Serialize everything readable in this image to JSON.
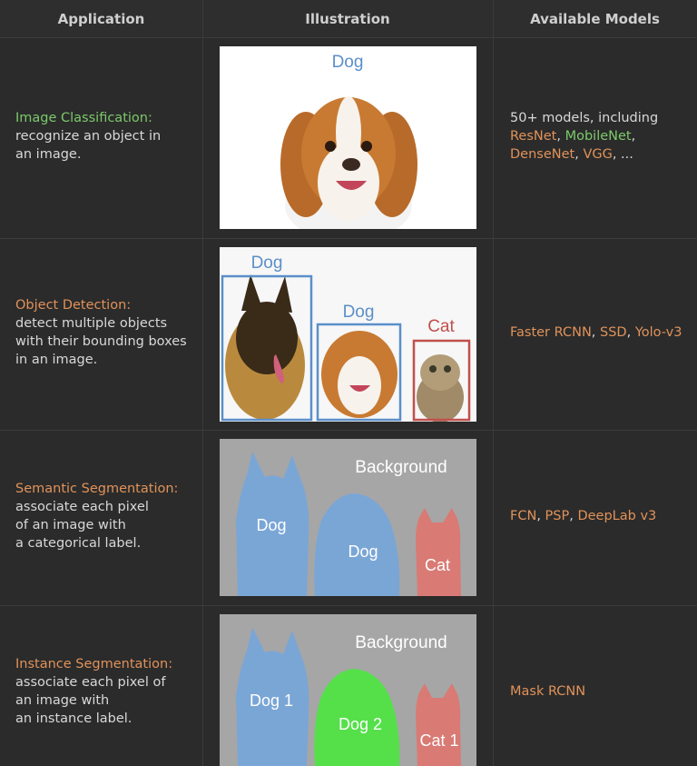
{
  "header": {
    "application": "Application",
    "illustration": "Illustration",
    "models": "Available Models"
  },
  "rows": [
    {
      "title": "Image Classification:",
      "desc": [
        "recognize an object in",
        "an image."
      ],
      "models_line1": "50+ models, including",
      "models": [
        "ResNet",
        ", ",
        "MobileNet",
        ",",
        "DenseNet",
        ", ",
        "VGG",
        ", ..."
      ],
      "labels": [
        "Dog"
      ]
    },
    {
      "title": "Object Detection:",
      "desc": [
        "detect multiple objects",
        "with their bounding boxes",
        "in an image."
      ],
      "models": [
        "Faster RCNN",
        ", ",
        "SSD",
        ", ",
        "Yolo-v3"
      ],
      "labels": [
        "Dog",
        "Dog",
        "Cat"
      ]
    },
    {
      "title": "Semantic Segmentation:",
      "desc": [
        "associate each pixel",
        "of an image with",
        "a categorical label."
      ],
      "models": [
        "FCN",
        ", ",
        "PSP",
        ", ",
        "DeepLab v3"
      ],
      "labels": [
        "Background",
        "Dog",
        "Dog",
        "Cat"
      ]
    },
    {
      "title": "Instance Segmentation:",
      "desc": [
        "associate each pixel of",
        "an image with",
        "an instance label."
      ],
      "models": [
        "Mask RCNN"
      ],
      "labels": [
        "Background",
        "Dog 1",
        "Dog 2",
        "Cat 1"
      ]
    }
  ],
  "colors": {
    "green": "#7cc96a",
    "orange": "#e0925a",
    "box_blue": "#5b8fc9",
    "box_red": "#c0504d"
  }
}
